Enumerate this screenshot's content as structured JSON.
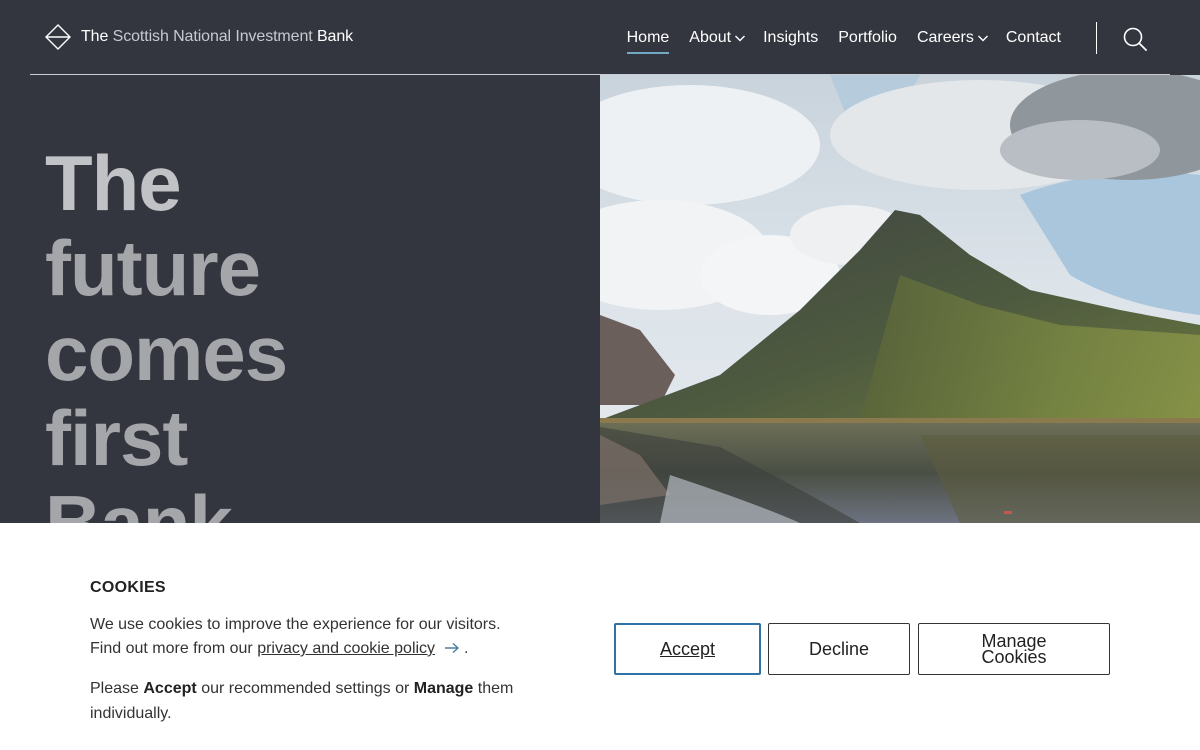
{
  "header": {
    "logo": {
      "prefix": "The",
      "middle": "Scottish National Investment",
      "suffix": "Bank"
    },
    "nav": [
      {
        "label": "Home",
        "active": true,
        "has_dropdown": false
      },
      {
        "label": "About",
        "active": false,
        "has_dropdown": true
      },
      {
        "label": "Insights",
        "active": false,
        "has_dropdown": false
      },
      {
        "label": "Portfolio",
        "active": false,
        "has_dropdown": false
      },
      {
        "label": "Careers",
        "active": false,
        "has_dropdown": true
      },
      {
        "label": "Contact",
        "active": false,
        "has_dropdown": false
      }
    ],
    "search_icon": "search-icon"
  },
  "hero": {
    "headline_lines": [
      "The",
      "future",
      "comes",
      "first",
      "Bank"
    ],
    "image_icon": "mountain-lake-photo"
  },
  "cookie_banner": {
    "title": "COOKIES",
    "text_line1": "We use cookies to improve the experience for our visitors.",
    "text_line2_prefix": "Find out more from our",
    "policy_link": "privacy and cookie policy",
    "text_line2_suffix": ".",
    "text2_prefix": "Please",
    "text2_accept": "Accept",
    "text2_middle": "our recommended settings or",
    "text2_manage": "Manage",
    "text2_suffix": "them individually.",
    "buttons": {
      "accept": "Accept",
      "decline": "Decline",
      "manage": "Manage Cookies"
    }
  },
  "colors": {
    "background": "#33363f",
    "nav_active_underline": "#6fa9c4",
    "accept_border": "#2f72a8",
    "headline_text": "#a4a6aa"
  }
}
